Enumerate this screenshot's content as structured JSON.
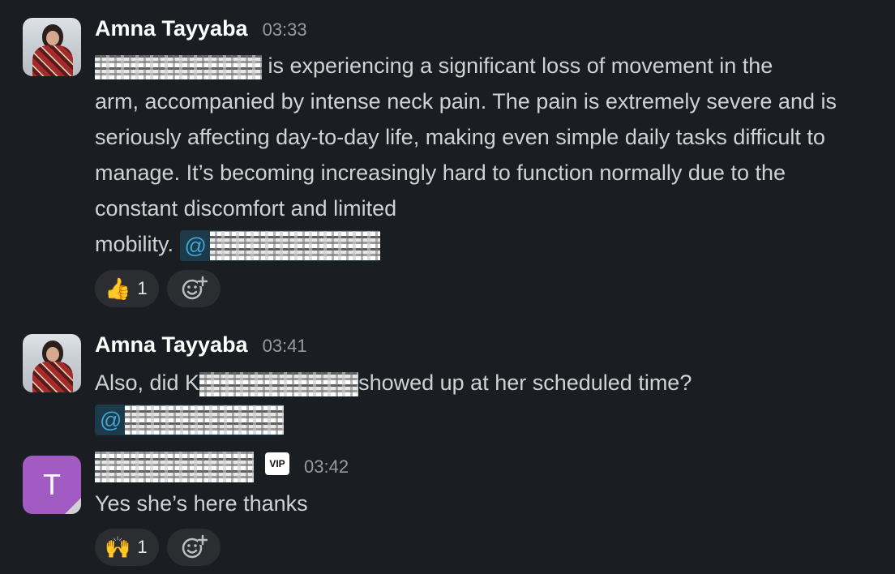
{
  "messages": [
    {
      "author": "Amna Tayyaba",
      "time": "03:33",
      "text_line1": " is experiencing a significant loss of movement in the",
      "text_rest": "arm, accompanied by intense neck pain. The pain is extremely severe and is seriously affecting day-to-day life, making even simple daily tasks difficult to manage. It’s becoming increasingly hard to function normally due to the constant discomfort and limited",
      "text_end": "mobility. ",
      "mention_prefix": "@",
      "reaction": {
        "emoji": "👍",
        "count": "1"
      }
    },
    {
      "author": "Amna Tayyaba",
      "time": "03:41",
      "text_start": "Also, did K",
      "text_after": "showed up at her scheduled time?",
      "mention_prefix": "@"
    },
    {
      "avatar_letter": "T",
      "badge": "VIP",
      "time": "03:42",
      "text": "Yes she’s here thanks",
      "reaction": {
        "emoji": "🙌",
        "count": "1"
      }
    }
  ],
  "icons": {
    "add_reaction": "smiley-plus-icon"
  }
}
